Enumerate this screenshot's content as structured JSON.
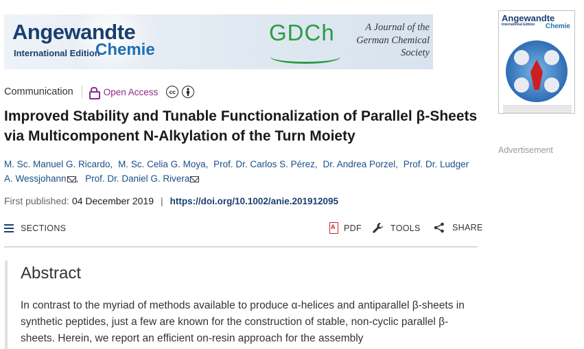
{
  "banner": {
    "journal_line1": "Angewandte",
    "journal_edition": "International Edition",
    "journal_line2": "Chemie",
    "society_logo": "GDCh",
    "tagline": "A Journal of the German Chemical Society"
  },
  "cover": {
    "title": "Angewandte",
    "subtitle": "International Edition",
    "chemie": "Chemie"
  },
  "advertisement_label": "Advertisement",
  "article": {
    "type": "Communication",
    "access": "Open Access",
    "license_cc": "cc",
    "title": "Improved Stability and Tunable Functionalization of Parallel β-Sheets via Multicomponent N-Alkylation of the Turn Moiety",
    "authors": [
      "M. Sc. Manuel G. Ricardo,",
      "M. Sc. Celia G. Moya,",
      "Prof. Dr. Carlos S. Pérez,",
      "Dr. Andrea Porzel,",
      "Prof. Dr. Ludger A. Wessjohann",
      ",",
      "Prof. Dr. Daniel G. Rivera"
    ],
    "first_published_label": "First published:",
    "first_published_date": "04 December 2019",
    "doi": "https://doi.org/10.1002/anie.201912095"
  },
  "toolbar": {
    "sections": "SECTIONS",
    "pdf": "PDF",
    "tools": "TOOLS",
    "share": "SHARE"
  },
  "abstract": {
    "heading": "Abstract",
    "text": "In contrast to the myriad of methods available to produce α-helices and antiparallel β-sheets in synthetic peptides, just a few are known for the construction of stable, non-cyclic parallel β-sheets. Herein, we report an efficient on-resin approach for the assembly"
  },
  "colors": {
    "open_access": "#8b2a8b",
    "author_link": "#1a4e8a",
    "doi_link": "#1b3e6f",
    "gdch_green": "#2e9a45"
  }
}
